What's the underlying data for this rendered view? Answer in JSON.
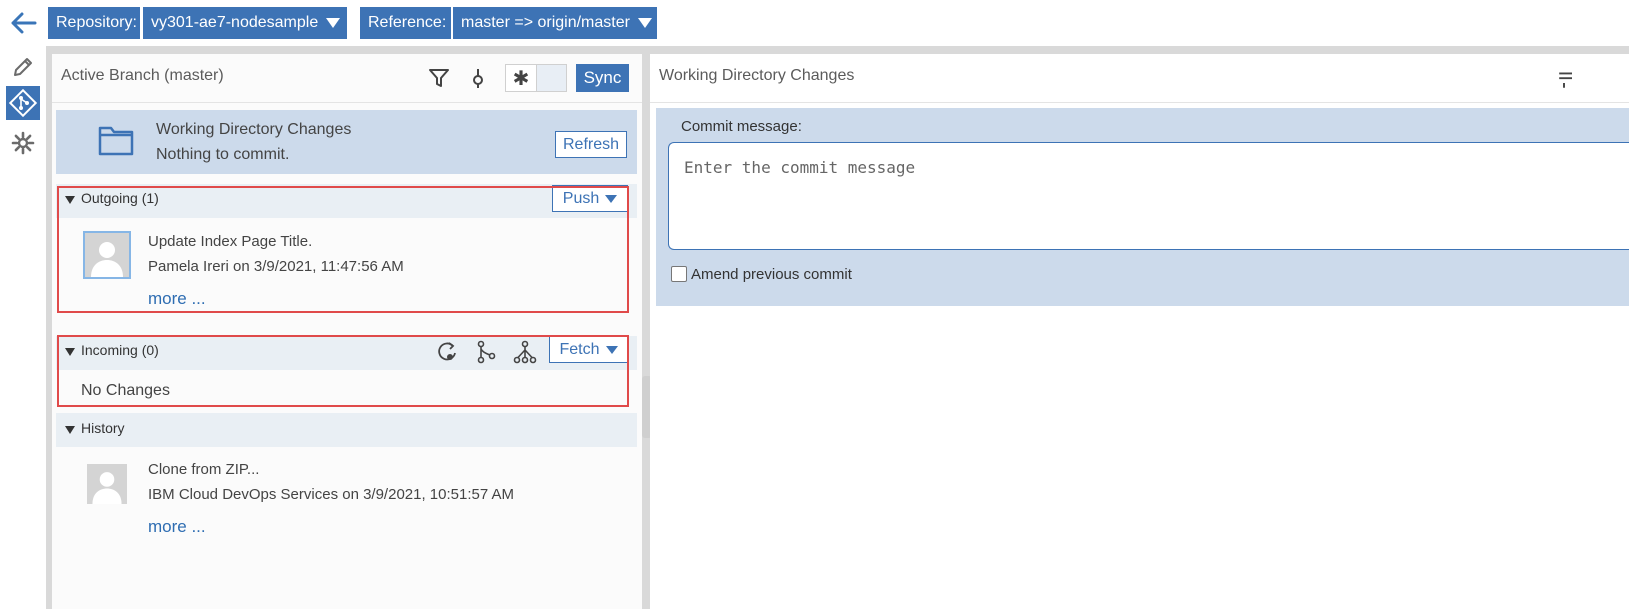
{
  "topbar": {
    "repository_label": "Repository:",
    "repository_value": "vy301-ae7-nodesample",
    "reference_label": "Reference:",
    "reference_value": "master => origin/master"
  },
  "left": {
    "title": "Active Branch (master)",
    "sync_label": "Sync",
    "toggle_icon": "asterisk",
    "working_dir": {
      "title": "Working Directory Changes",
      "status": "Nothing to commit.",
      "refresh_label": "Refresh"
    },
    "outgoing": {
      "title": "Outgoing (1)",
      "push_label": "Push",
      "commit": {
        "message": "Update Index Page Title.",
        "author_line": "Pamela Ireri on 3/9/2021, 11:47:56 AM",
        "more": "more ..."
      }
    },
    "incoming": {
      "title": "Incoming (0)",
      "fetch_label": "Fetch",
      "empty": "No Changes"
    },
    "history": {
      "title": "History",
      "commit": {
        "message": "Clone from ZIP...",
        "author_line": "IBM Cloud DevOps Services on 3/9/2021, 10:51:57 AM",
        "more": "more ..."
      }
    }
  },
  "right": {
    "title": "Working Directory Changes",
    "commit_label": "Commit message:",
    "commit_placeholder": "Enter the commit message",
    "amend_label": "Amend previous commit"
  },
  "colors": {
    "accent": "#3d73b5",
    "highlight": "#e04a4a",
    "panel": "#ccdaeb"
  }
}
